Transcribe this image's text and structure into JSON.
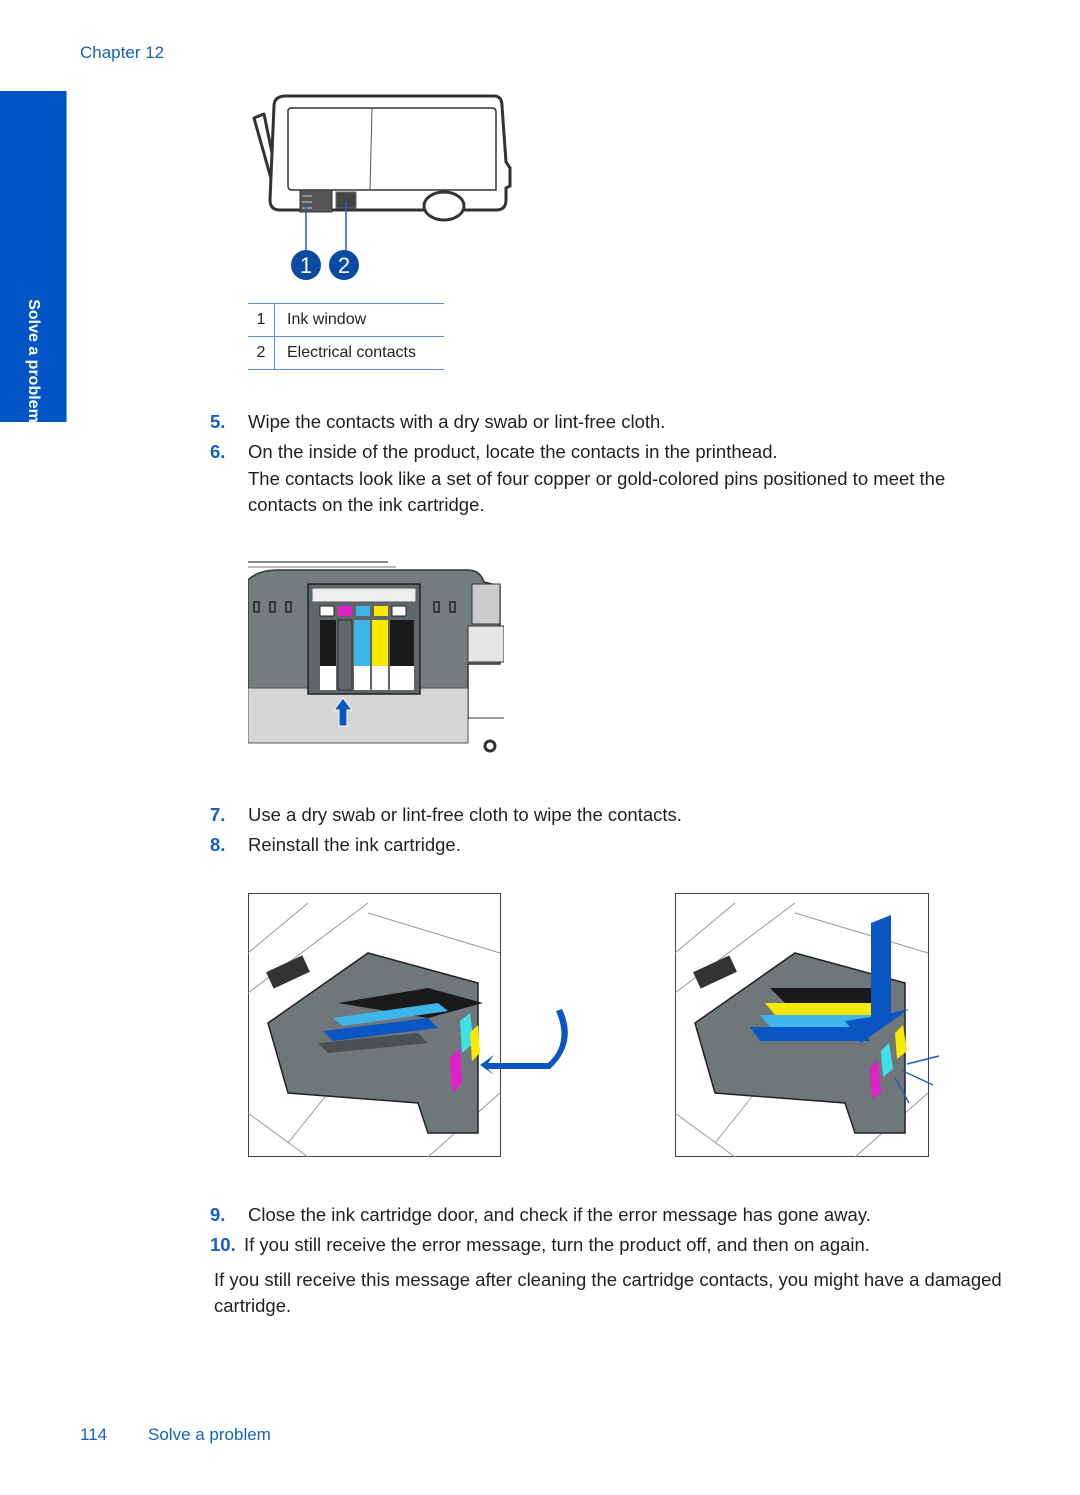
{
  "header": {
    "chapter": "Chapter 12"
  },
  "side_tab": {
    "label": "Solve a problem"
  },
  "figure1": {
    "callouts": [
      "1",
      "2"
    ],
    "legend": [
      {
        "num": "1",
        "label": "Ink window"
      },
      {
        "num": "2",
        "label": "Electrical contacts"
      }
    ]
  },
  "steps": [
    {
      "num": "5.",
      "text": "Wipe the contacts with a dry swab or lint-free cloth."
    },
    {
      "num": "6.",
      "text": "On the inside of the product, locate the contacts in the printhead."
    },
    {
      "num": "7.",
      "text": "Use a dry swab or lint-free cloth to wipe the contacts."
    },
    {
      "num": "8.",
      "text": "Reinstall the ink cartridge."
    },
    {
      "num": "9.",
      "text": "Close the ink cartridge door, and check if the error message has gone away."
    },
    {
      "num": "10.",
      "text": "If you still receive the error message, turn the product off, and then on again."
    }
  ],
  "step6_detail": "The contacts look like a set of four copper or gold-colored pins positioned to meet the contacts on the ink cartridge.",
  "closing": "If you still receive this message after cleaning the cartridge contacts, you might have a damaged cartridge.",
  "footer": {
    "page_number": "114",
    "section": "Solve a problem"
  },
  "colors": {
    "accent": "#1560bd",
    "tab": "#0055c6",
    "cyan": "#3fb6ea",
    "magenta": "#e020c8",
    "yellow": "#f5ea00",
    "black": "#1a1a1a"
  }
}
